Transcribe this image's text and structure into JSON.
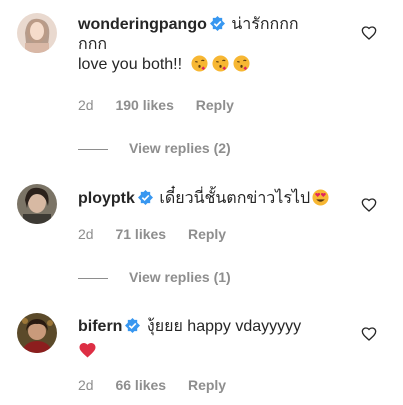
{
  "comments": [
    {
      "username": "wonderingpango",
      "text_line1": "น่ารักกกก",
      "text_line2": "กกก",
      "text_line3": "love you both!!",
      "age": "2d",
      "likes": "190 likes",
      "reply": "Reply",
      "view_replies": "View replies (2)"
    },
    {
      "username": "ploy ptk",
      "username_display": "ployptk",
      "text_line1": "เดี๋ยวนี่ชั้นตกข่าวไรไป",
      "age": "2d",
      "likes": "71 likes",
      "reply": "Reply",
      "view_replies": "View replies (1)"
    },
    {
      "username": "bifern",
      "text_line1": "งุ้ยยย happy vdayyyyy",
      "age": "2d",
      "likes": "66 likes",
      "reply": "Reply"
    }
  ],
  "icons": {
    "verified": "verified-badge-icon",
    "like": "heart-outline-icon",
    "emoji_kiss": "face-blowing-kiss-emoji",
    "emoji_heart_eyes": "smiling-face-heart-eyes-emoji",
    "emoji_red_heart": "red-heart-emoji"
  },
  "colors": {
    "verified": "#3897f0",
    "muted": "#8e8e8e",
    "text": "#262626"
  }
}
